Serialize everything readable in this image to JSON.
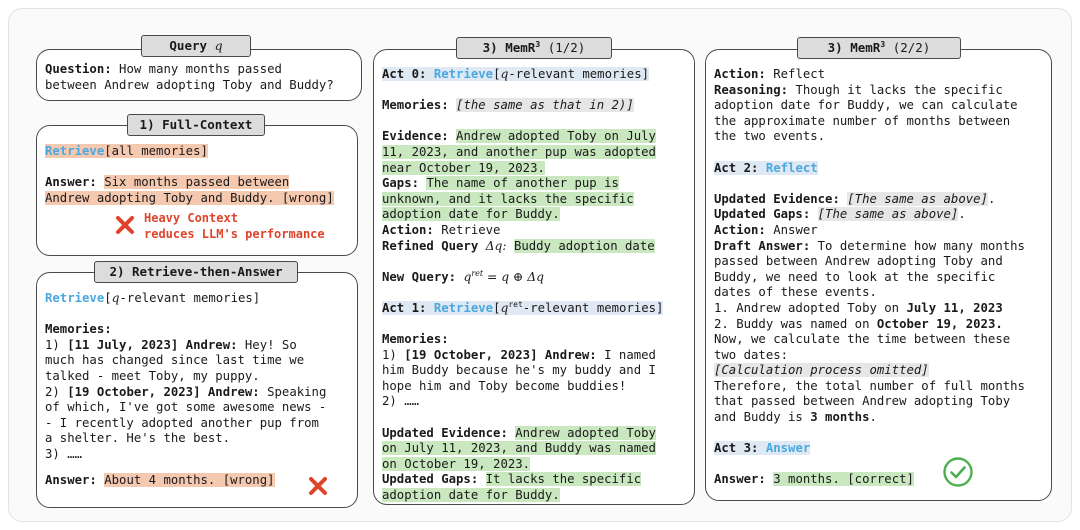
{
  "query": {
    "tag": "Query",
    "tag_var": "q",
    "q_label": "Question:",
    "q_line1": "How many months passed",
    "q_line2": "between Andrew adopting Toby and Buddy?"
  },
  "full_context": {
    "tag": "1) Full-Context",
    "retrieve": "Retrieve",
    "retrieve_arg": "[all memories]",
    "answer_label": "Answer:",
    "answer_line1": "Six months passed between",
    "answer_line2": "Andrew adopting Toby and Buddy. [wrong]",
    "warn1": "Heavy Context",
    "warn2": "reduces LLM's performance"
  },
  "rta": {
    "tag": "2) Retrieve-then-Answer",
    "retrieve": "Retrieve",
    "retrieve_open": "[",
    "retrieve_var": "q",
    "retrieve_rest": "-relevant memories]",
    "memories_label": "Memories:",
    "m1_num": "1)",
    "m1_head": "[11 July, 2023] Andrew:",
    "m1_t1": "Hey! So",
    "m1_t2": "much has changed since last time we",
    "m1_t3": "talked - meet Toby, my puppy.",
    "m2_num": "2)",
    "m2_head": "[19 October, 2023] Andrew:",
    "m2_t1": "Speaking",
    "m2_t2": "of which, I've got some awesome news -",
    "m2_t3": "- I recently adopted another pup from",
    "m2_t4": "a shelter. He's the best.",
    "m3": "3) ……",
    "answer_label": "Answer:",
    "answer_text": "About 4 months. [wrong]"
  },
  "memr1": {
    "tag": "3) MemR",
    "tag_sup": "3",
    "tag_count": "(1/2)",
    "act0_label": "Act 0:",
    "act0_op": "Retrieve",
    "act0_open": "[",
    "act0_var": "q",
    "act0_rest": "-relevant memories]",
    "mem_label": "Memories:",
    "mem_text": "[the same as that in 2)]",
    "ev_label": "Evidence:",
    "ev1": "Andrew adopted Toby on July",
    "ev2": "11, 2023, and another pup was adopted",
    "ev3": "near October 19, 2023.",
    "gaps_label": "Gaps:",
    "gaps1": "The name of another pup is",
    "gaps2": "unknown, and it lacks the specific",
    "gaps3": "adoption date for Buddy.",
    "action_label": "Action:",
    "action_val": "Retrieve",
    "rq_label": "Refined Query",
    "rq_sym": "Δq:",
    "rq_val": "Buddy adoption date",
    "nq_label": "New Query:",
    "nq_formula": "q = q ⊕ Δq",
    "nq_sup": "ret",
    "act1_label": "Act 1:",
    "act1_op": "Retrieve",
    "act1_open": "[",
    "act1_var": "q",
    "act1_sup": "ret",
    "act1_rest": "-relevant memories]",
    "mem2_label": "Memories:",
    "mm1_num": "1)",
    "mm1_head": "[19 October, 2023] Andrew:",
    "mm1_t1": "I named",
    "mm1_t2": "him Buddy because he's my buddy and I",
    "mm1_t3": "hope him and Toby become buddies!",
    "mm2": "2) ……",
    "uev_label": "Updated Evidence:",
    "uev1": "Andrew adopted Toby",
    "uev2": "on July 11, 2023, and Buddy was named",
    "uev3": "on October 19, 2023.",
    "ugaps_label": "Updated Gaps:",
    "ugaps1": "It lacks the specific",
    "ugaps2": "adoption date for Buddy."
  },
  "memr2": {
    "tag": "3) MemR",
    "tag_sup": "3",
    "tag_count": "(2/2)",
    "action_label": "Action:",
    "action_val": "Reflect",
    "reason_label": "Reasoning:",
    "reason1": "Though it lacks the specific",
    "reason2": "adoption date for Buddy, we can calculate",
    "reason3": "the approximate number of months between",
    "reason4": "the two events.",
    "act2_label": "Act 2:",
    "act2_op": "Reflect",
    "uev_label": "Updated Evidence:",
    "uev_val": "[The same as above]",
    "uev_dot": ".",
    "ugaps_label": "Updated Gaps:",
    "ugaps_val": "[The same as above]",
    "ugaps_dot": ".",
    "action2_label": "Action:",
    "action2_val": "Answer",
    "draft_label": "Draft Answer:",
    "draft1": "To determine how many months",
    "draft2": "passed between Andrew adopting Toby and",
    "draft3": "Buddy, we need to look at the specific",
    "draft4": "dates of these events.",
    "d5a": "1. Andrew adopted Toby on",
    "d5b": "July 11, 2023",
    "d6a": "2. Buddy was named on",
    "d6b": "October 19, 2023.",
    "draft7": "Now, we calculate the time between these",
    "draft8": "two dates:",
    "calc": "[Calculation process omitted]",
    "draft9": "Therefore, the total number of full months",
    "draft10": "that passed between Andrew adopting Toby",
    "d11a": "and Buddy is",
    "d11b": "3 months",
    "d11c": ".",
    "act3_label": "Act 3:",
    "act3_op": "Answer",
    "answer_label": "Answer:",
    "answer_val": "3 months. [correct]"
  },
  "colors": {
    "highlight_green": "#c9e8bf",
    "highlight_orange": "#f5c8b0",
    "highlight_blue": "#dfe9f3",
    "operation_blue": "#4aa8e0",
    "error_red": "#e0432b",
    "check_green": "#4caf50"
  },
  "icons": {
    "wrong": "cross-icon",
    "correct": "check-circle-icon"
  }
}
